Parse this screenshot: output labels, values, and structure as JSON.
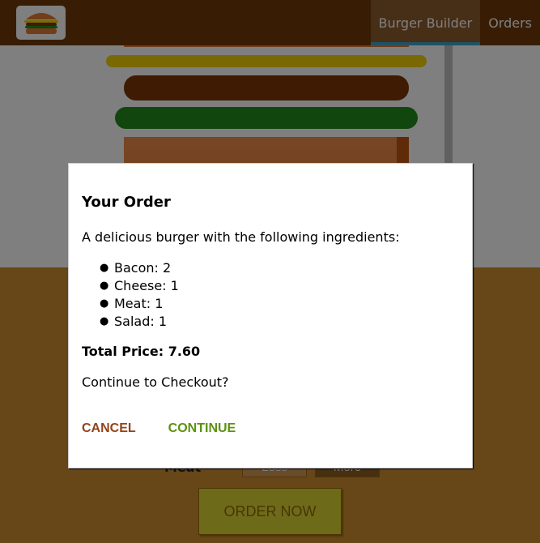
{
  "nav": {
    "logo_icon": "burger-logo-icon",
    "items": [
      {
        "label": "Burger Builder",
        "active": true
      },
      {
        "label": "Orders",
        "active": false
      }
    ]
  },
  "controls": {
    "meat_label": "Meat",
    "less_label": "Less",
    "more_label": "More",
    "order_now_label": "ORDER NOW"
  },
  "modal": {
    "title": "Your Order",
    "intro": "A delicious burger with the following ingredients:",
    "ingredients": [
      {
        "text": "Bacon: 2"
      },
      {
        "text": "Cheese: 1"
      },
      {
        "text": "Meat: 1"
      },
      {
        "text": "Salad: 1"
      }
    ],
    "total": "Total Price: 7.60",
    "checkout_question": "Continue to Checkout?",
    "cancel_label": "CANCEL",
    "continue_label": "CONTINUE"
  },
  "colors": {
    "toolbar": "#703b09",
    "background": "#cf8f2e",
    "cancel": "#944317",
    "continue": "#5c9210"
  }
}
